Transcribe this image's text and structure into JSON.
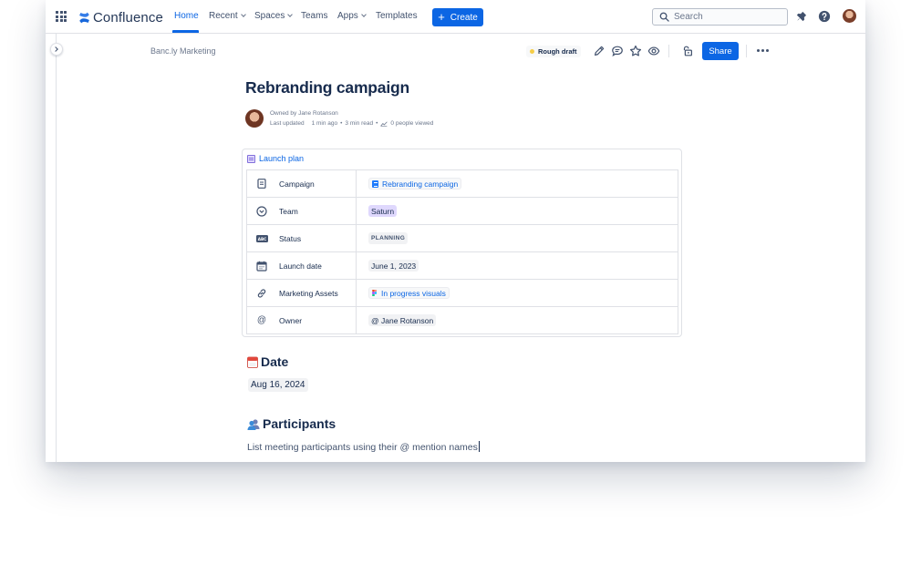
{
  "app": {
    "name": "Confluence"
  },
  "nav": {
    "items": [
      {
        "label": "Home",
        "active": true
      },
      {
        "label": "Recent",
        "dropdown": true
      },
      {
        "label": "Spaces",
        "dropdown": true
      },
      {
        "label": "Teams"
      },
      {
        "label": "Apps",
        "dropdown": true
      },
      {
        "label": "Templates"
      }
    ],
    "create_label": "Create",
    "search_placeholder": "Search",
    "icons": [
      "apps-grid-icon",
      "notification-icon",
      "help-icon",
      "profile-avatar"
    ]
  },
  "breadcrumb": "Banc.ly Marketing",
  "toolbar": {
    "status_badge": "Rough draft",
    "share_label": "Share",
    "icons": [
      "edit-icon",
      "comment-icon",
      "star-icon",
      "watch-icon",
      "restrictions-icon",
      "more-icon"
    ]
  },
  "page": {
    "title": "Rebranding campaign",
    "owned_by": "Owned by Jane Rotanson",
    "last_updated": "Last updated",
    "updated_ago": "1 min ago",
    "read_time": "3 min read",
    "views": "0 people viewed"
  },
  "launch_plan": {
    "title": "Launch plan",
    "rows": [
      {
        "label": "Campaign",
        "value": "Rebranding campaign",
        "kind": "page-link",
        "icon": "page-icon"
      },
      {
        "label": "Team",
        "value": "Saturn",
        "kind": "team",
        "icon": "dropdown-circle-icon"
      },
      {
        "label": "Status",
        "value": "PLANNING",
        "kind": "status",
        "icon": "text-field-icon"
      },
      {
        "label": "Launch date",
        "value": "June 1, 2023",
        "kind": "date",
        "icon": "calendar-icon"
      },
      {
        "label": "Marketing Assets",
        "value": "In progress visuals",
        "kind": "figma-link",
        "icon": "link-icon"
      },
      {
        "label": "Owner",
        "value": "@ Jane Rotanson",
        "kind": "mention",
        "icon": "mention-icon"
      }
    ]
  },
  "sections": {
    "date": {
      "heading": "Date",
      "value": "Aug 16, 2024",
      "emoji": "calendar"
    },
    "participants": {
      "heading": "Participants",
      "placeholder": "List meeting participants using their @ mention names",
      "emoji": "people"
    }
  },
  "colors": {
    "brand": "#0c66e4",
    "text": "#172b4d",
    "subtle": "#6b778c",
    "team_chip": "#dfd8fd",
    "draft_dot": "#f5cd47"
  }
}
